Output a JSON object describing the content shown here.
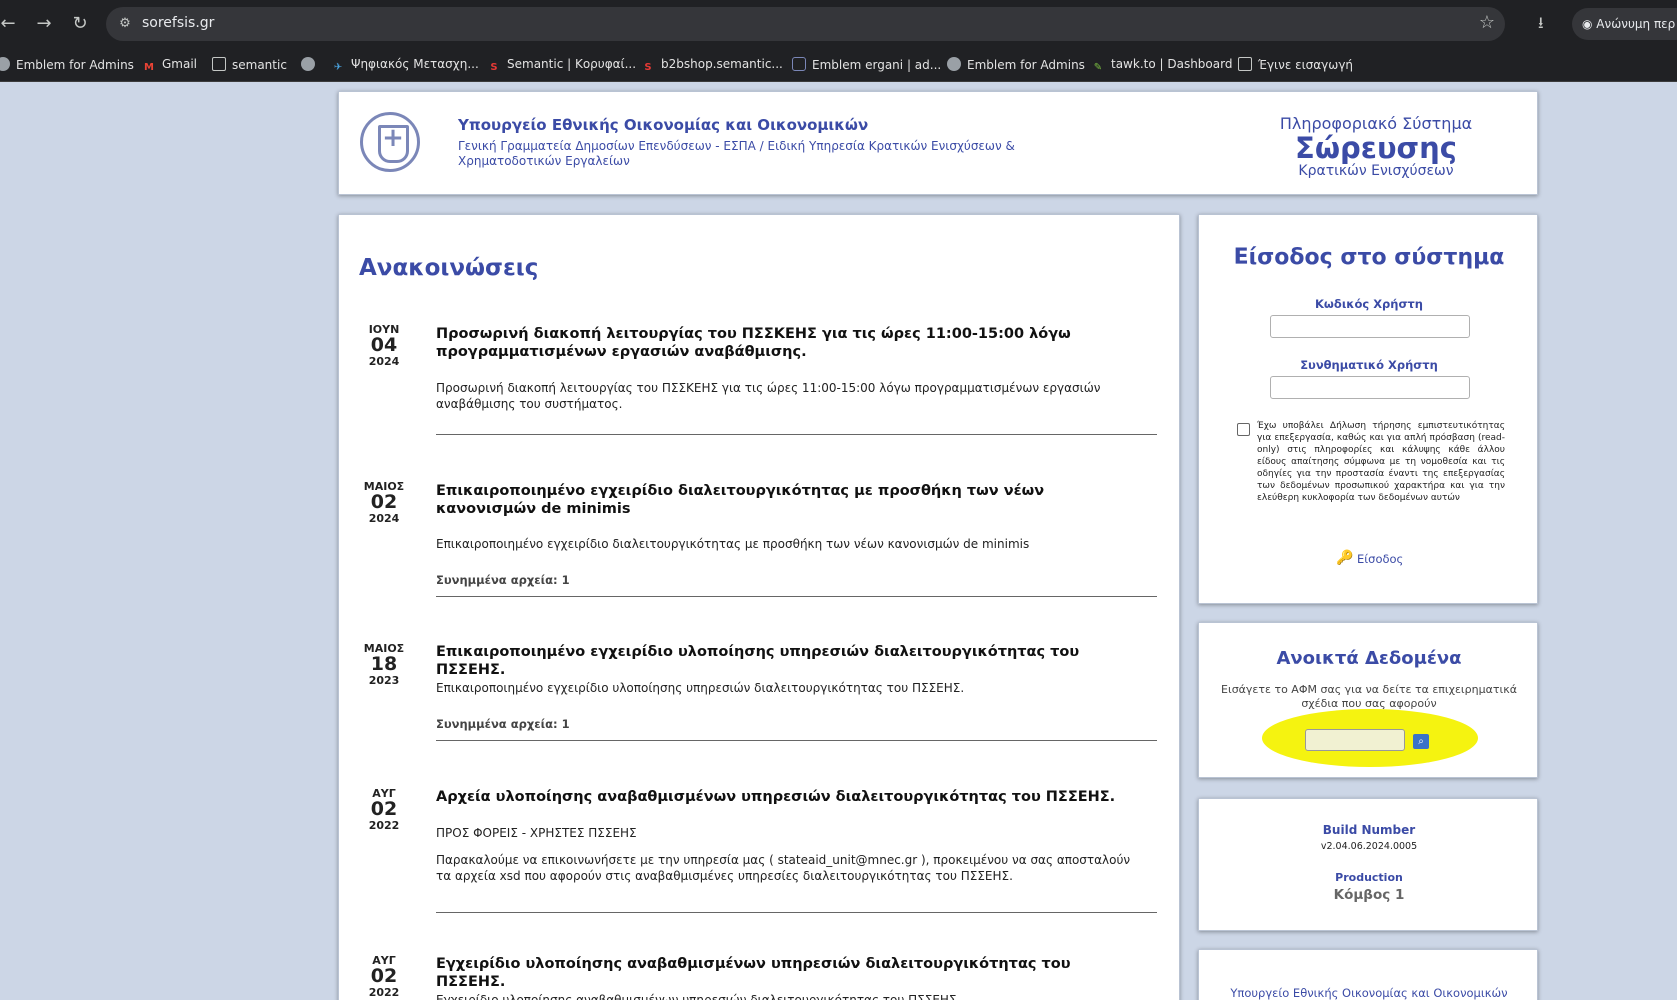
{
  "browser": {
    "url": "sorefsis.gr",
    "incognito_label": "Ανώνυμη περ",
    "bookmarks": [
      {
        "label": "Emblem for Admins",
        "icon": "globe-icon"
      },
      {
        "label": "Gmail",
        "icon": "gmail-icon"
      },
      {
        "label": "semantic",
        "icon": "folder-icon"
      },
      {
        "label": "",
        "icon": "globe-icon"
      },
      {
        "label": "Ψηφιακός Μετασχη...",
        "icon": "bird-icon"
      },
      {
        "label": "Semantic | Κορυφαί...",
        "icon": "s-icon"
      },
      {
        "label": "b2bshop.semantic...",
        "icon": "s-icon"
      },
      {
        "label": "Emblem ergani | ad...",
        "icon": "shield-icon"
      },
      {
        "label": "Emblem for Admins",
        "icon": "globe-icon"
      },
      {
        "label": "tawk.to | Dashboard",
        "icon": "tawk-icon"
      },
      {
        "label": "Έγινε εισαγωγή",
        "icon": "folder-icon"
      }
    ]
  },
  "header": {
    "ministry": "Υπουργείο Εθνικής Οικονομίας και Οικονομικών",
    "secretariat": "Γενική Γραμματεία Δημοσίων Επενδύσεων - ΕΣΠΑ / Ειδική Υπηρεσία Κρατικών Ενισχύσεων & Χρηματοδοτικών Εργαλείων",
    "system_line1": "Πληροφοριακό Σύστημα",
    "system_line2": "Σώρευσης",
    "system_line3": "Κρατικών Ενισχύσεων"
  },
  "announcements": {
    "heading": "Ανακοινώσεις",
    "items": [
      {
        "month": "ΙΟΥΝ",
        "day": "04",
        "year": "2024",
        "title": "Προσωρινή διακοπή λειτουργίας του ΠΣΣΚΕΗΣ για τις ώρες 11:00-15:00 λόγω προγραμματισμένων εργασιών αναβάθμισης.",
        "body": "Προσωρινή διακοπή λειτουργίας του ΠΣΣΚΕΗΣ για τις ώρες 11:00-15:00 λόγω προγραμματισμένων εργασιών αναβάθμισης του συστήματος.",
        "files": ""
      },
      {
        "month": "ΜΑΙΟΣ",
        "day": "02",
        "year": "2024",
        "title": "Επικαιροποιημένο εγχειρίδιο διαλειτουργικότητας με προσθήκη των νέων κανονισμών de minimis",
        "body": "Επικαιροποιημένο εγχειρίδιο διαλειτουργικότητας με προσθήκη των νέων κανονισμών de minimis",
        "files": "Συνημμένα αρχεία: 1"
      },
      {
        "month": "ΜΑΙΟΣ",
        "day": "18",
        "year": "2023",
        "title": "Επικαιροποιημένο εγχειρίδιο υλοποίησης υπηρεσιών διαλειτουργικότητας του ΠΣΣΕΗΣ.",
        "body": "Επικαιροποιημένο εγχειρίδιο υλοποίησης υπηρεσιών διαλειτουργικότητας του ΠΣΣΕΗΣ.",
        "files": "Συνημμένα αρχεία: 1"
      },
      {
        "month": "ΑΥΓ",
        "day": "02",
        "year": "2022",
        "title": "Αρχεία υλοποίησης αναβαθμισμένων υπηρεσιών διαλειτουργικότητας του ΠΣΣΕΗΣ.",
        "body": "ΠΡΟΣ ΦΟΡΕΙΣ - ΧΡΗΣΤΕΣ ΠΣΣΕΗΣ",
        "body2": "Παρακαλούμε να επικοινωνήσετε με την υπηρεσία μας ( stateaid_unit@mnec.gr ), προκειμένου να σας αποσταλούν τα αρχεία xsd που αφορούν στις αναβαθμισμένες υπηρεσίες διαλειτουργικότητας του ΠΣΣΕΗΣ.",
        "files": ""
      },
      {
        "month": "ΑΥΓ",
        "day": "02",
        "year": "2022",
        "title": "Εγχειρίδιο υλοποίησης αναβαθμισμένων υπηρεσιών διαλειτουργικότητας του ΠΣΣΕΗΣ.",
        "body": "Εγχειρίδιο υλοποίησης αναβαθμισμένων υπηρεσιών διαλειτουργικότητας του ΠΣΣΕΗΣ",
        "files": ""
      }
    ]
  },
  "login": {
    "heading": "Είσοδος στο σύστημα",
    "username_label": "Κωδικός Χρήστη",
    "password_label": "Συνθηματικό Χρήστη",
    "consent_text": "Έχω υποβάλει Δήλωση τήρησης εμπιστευτικότητας για επεξεργασία, καθώς και για απλή πρόσβαση (read-only) στις πληροφορίες και κάλυψης κάθε άλλου είδους απαίτησης σύμφωνα με τη νομοθεσία και τις οδηγίες για την προστασία έναντι της επεξεργασίας των δεδομένων προσωπικού χαρακτήρα και για την ελεύθερη κυκλοφορία των δεδομένων αυτών",
    "submit_label": "Είσοδος"
  },
  "open_data": {
    "heading": "Ανοικτά Δεδομένα",
    "description": "Εισάγετε το ΑΦΜ σας για να δείτε τα επιχειρηματικά σχέδια που σας αφορούν",
    "highlight_color": "#f5f310"
  },
  "build": {
    "label": "Build Number",
    "value": "v2.04.06.2024.0005",
    "environment": "Production",
    "node": "Κόμβος 1"
  },
  "footer": {
    "ministry": "Υπουργείο Εθνικής Οικονομίας και Οικονομικών"
  }
}
